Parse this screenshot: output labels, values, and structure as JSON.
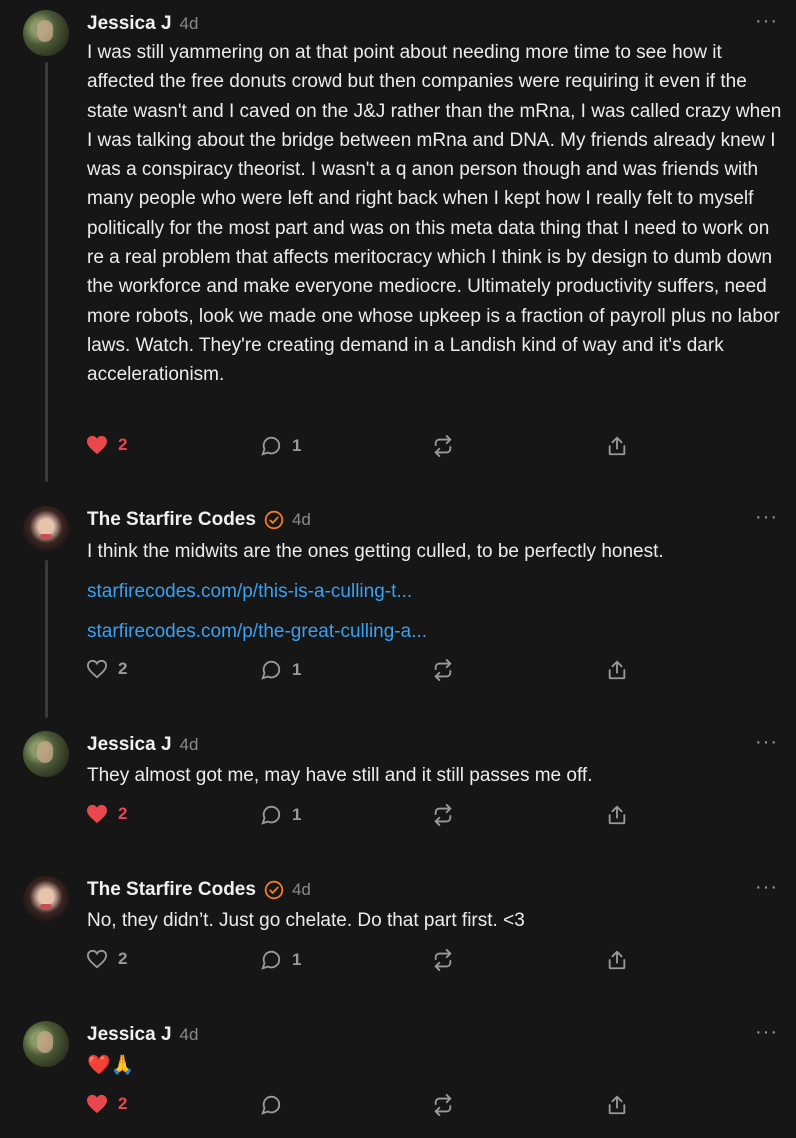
{
  "comments": [
    {
      "author": "Jessica J",
      "time": "4d",
      "verified": false,
      "text": "I was still yammering on at that point about needing more time to see how it affected the free donuts crowd but then companies were requiring it even if the state wasn't and I caved on the J&J rather than the mRna, I was called crazy when I was talking about the bridge between mRna and DNA. My friends already knew I was a conspiracy theorist. I wasn't a q anon person though and was friends with many people who were left and right back when I kept how I really felt to myself politically for the most part and was on this meta data thing that I need to work on re a real problem that affects meritocracy which I think is by design to dumb down the workforce and make everyone mediocre. Ultimately productivity suffers, need more robots, look we made one whose upkeep is a fraction of payroll plus no labor laws. Watch. They're creating demand in a Landish kind of way and it's dark accelerationism.",
      "likes": "2",
      "liked": true,
      "replies": "1"
    },
    {
      "author": "The Starfire Codes",
      "time": "4d",
      "verified": true,
      "text": "I think the midwits are the ones getting culled, to be perfectly honest.",
      "links": [
        "starfirecodes.com/p/this-is-a-culling-t...",
        "starfirecodes.com/p/the-great-culling-a..."
      ],
      "likes": "2",
      "liked": false,
      "replies": "1"
    },
    {
      "author": "Jessica J",
      "time": "4d",
      "verified": false,
      "text": "They almost got me, may have still and it still passes me off.",
      "likes": "2",
      "liked": true,
      "replies": "1"
    },
    {
      "author": "The Starfire Codes",
      "time": "4d",
      "verified": true,
      "text": "No, they didn’t. Just go chelate. Do that part first. <3",
      "likes": "2",
      "liked": false,
      "replies": "1"
    },
    {
      "author": "Jessica J",
      "time": "4d",
      "verified": false,
      "text": "❤️🙏",
      "likes": "2",
      "liked": true,
      "replies": ""
    }
  ],
  "more_label": "···",
  "colors": {
    "like_active": "#e8484d",
    "link": "#3aa0f0",
    "verified": "#f07a2a",
    "icon": "#9a9a9a"
  },
  "icons": [
    "heart-icon",
    "comment-icon",
    "restack-icon",
    "share-icon",
    "more-icon",
    "verified-badge-icon"
  ]
}
